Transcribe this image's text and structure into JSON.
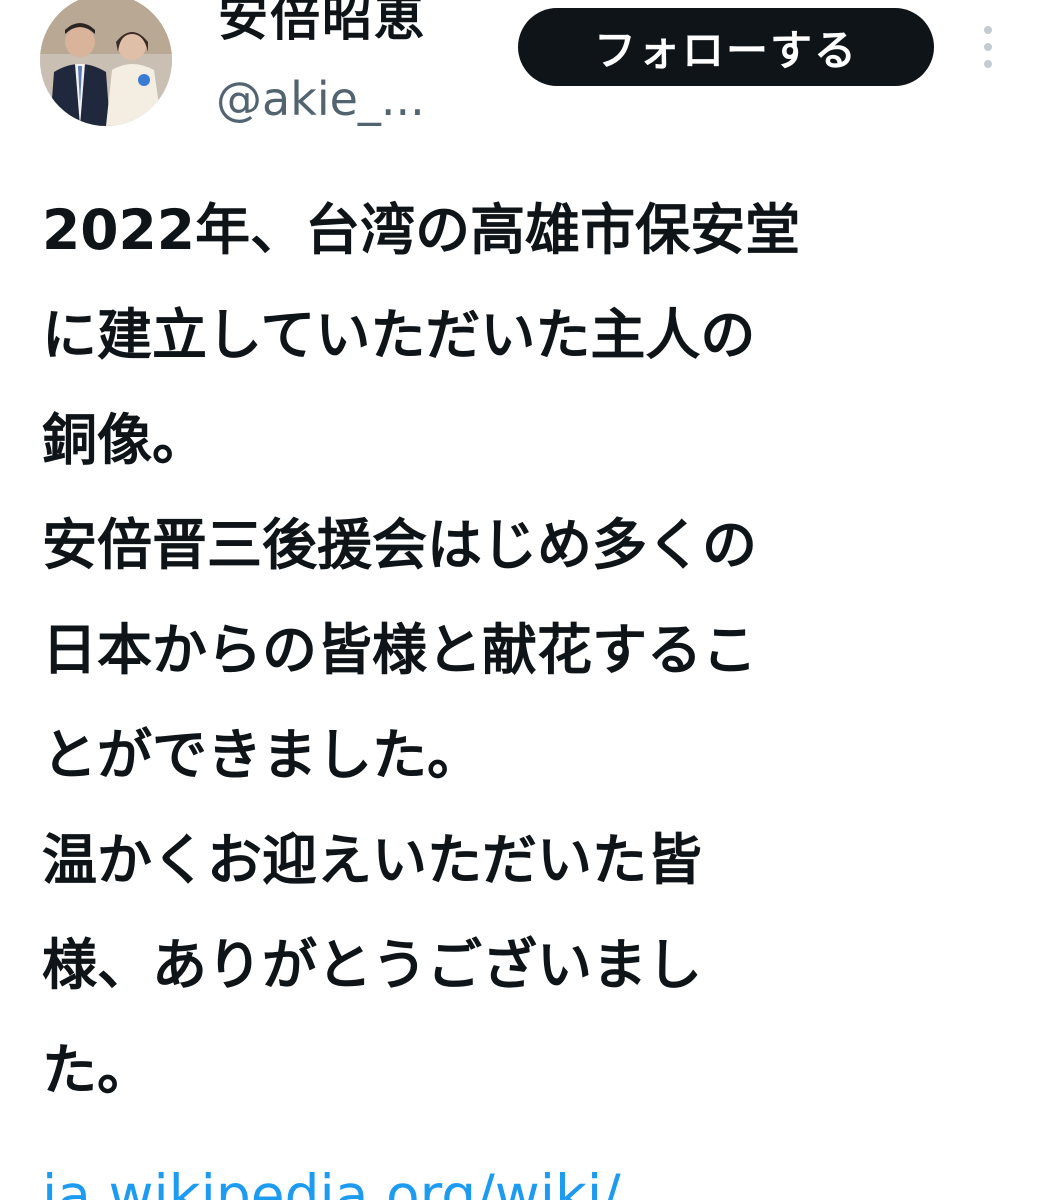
{
  "user": {
    "display_name": "安倍昭恵",
    "handle": "@akie_..."
  },
  "actions": {
    "follow_label": "フォローする",
    "more_icon": "more-vertical-icon"
  },
  "tweet": {
    "lines": [
      "2022年、台湾の高雄市保安堂",
      "に建立していただいた主人の",
      "銅像。",
      "安倍晋三後援会はじめ多くの",
      "日本からの皆様と献花するこ",
      "とができました。",
      "温かくお迎えいただいた皆",
      "様、ありがとうございまし",
      "た。"
    ],
    "link_text": "ja.wikipedia.org/wiki/"
  },
  "colors": {
    "text": "#0f1419",
    "secondary": "#536471",
    "link": "#1d9bf0",
    "button_bg": "#0f1419",
    "button_text": "#ffffff"
  }
}
